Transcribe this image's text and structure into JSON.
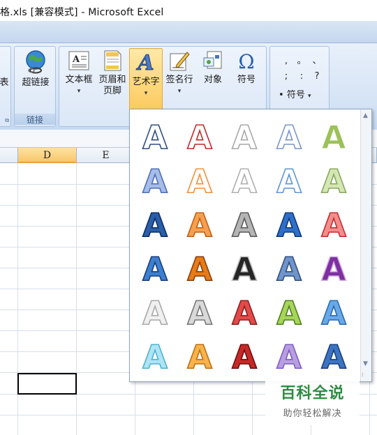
{
  "window": {
    "title": "格.xls  [兼容模式] - Microsoft Excel"
  },
  "ribbon": {
    "partial_button": "表",
    "hyperlink": "超链接",
    "group_links": "链接",
    "textbox": "文本框",
    "header_footer": [
      "页眉和",
      "页脚"
    ],
    "wordart": "艺术字",
    "signature": "签名行",
    "object": "对象",
    "symbol": "符号",
    "symbols_dropdown": "符号",
    "symbol_chars": [
      ",",
      "。",
      "、",
      ";",
      ":",
      "?",
      "•"
    ]
  },
  "sheet": {
    "columns": [
      "D",
      "E"
    ],
    "selected_column": "D"
  },
  "gallery": {
    "letter": "A",
    "styles": [
      [
        "#ffffff",
        "#2f4f7f",
        "#ffffff",
        "#bf2b2b",
        "#ffffff",
        "#a9a9a9",
        "#ffffff",
        "#7b97c6",
        "#9cc15a",
        "#ffffff"
      ],
      [
        "#a6bde8",
        "#4f6fb7",
        "#ffffff",
        "#f0903c",
        "#ffffff",
        "#b0b0b0",
        "#ffffff",
        "#5f95d6",
        "#d4e7b4",
        "#8aa85c"
      ],
      [
        "#2a5ea8",
        "#0e2d63",
        "#f6a04f",
        "#c25f16",
        "#b5b5b5",
        "#5b5b5b",
        "#2f6fc9",
        "#10387a",
        "#f28d8d",
        "#c22e2e"
      ],
      [
        "#3d7fd0",
        "#183e7a",
        "#e67b18",
        "#8b3c06",
        "#262626",
        "#bfbfbf",
        "#6f95cb",
        "#334f7d",
        "#7e2fa0",
        "#d2b2e6"
      ],
      [
        "#f0f0f0",
        "#a9a9a9",
        "#d9d9d9",
        "#777777",
        "#e34a4a",
        "#8e1d1d",
        "#a7d55a",
        "#4e7f21",
        "#69a9e6",
        "#2a6bb3"
      ],
      [
        "#aee4f4",
        "#4eb3d3",
        "#f6b44b",
        "#c26e12",
        "#c62828",
        "#6e0d0d",
        "#b89ee0",
        "#7d5cc4",
        "#3c74c3",
        "#1b3f7c"
      ]
    ]
  },
  "watermark": {
    "title": "百科全说",
    "subtitle": "助你轻松解决"
  }
}
